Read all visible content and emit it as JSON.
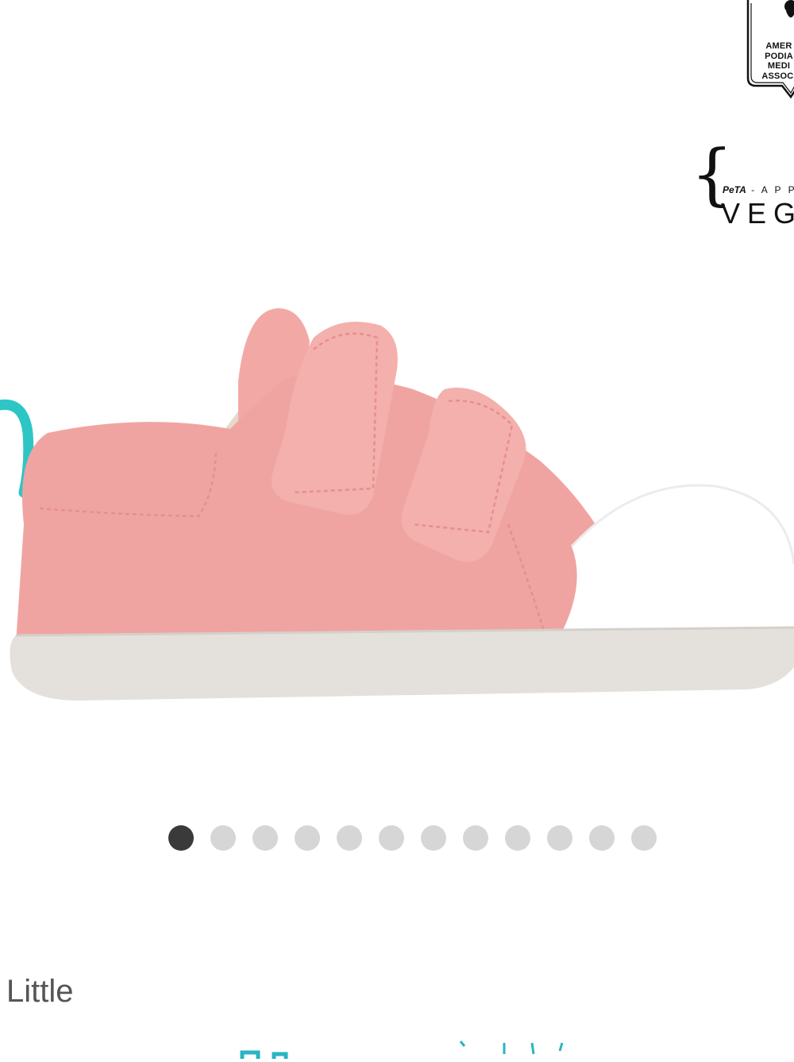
{
  "badges": {
    "apma": {
      "lines": [
        "AMER",
        "PODIA",
        "MEDI",
        "ASSOCI"
      ]
    },
    "peta": {
      "logo": "PeTA",
      "top_suffix": "- A P P R",
      "main": "VEG"
    }
  },
  "product": {
    "image_icon": "pink-velcro-sneaker-image",
    "colors": {
      "upper": "#f0a4a2",
      "toe_cap": "#ffffff",
      "sole": "#e4e1dc",
      "heel_tab": "#2ec5c5"
    }
  },
  "carousel": {
    "total": 12,
    "active_index": 0,
    "active_color": "#3a3a3a",
    "inactive_color": "#d6d6d6"
  },
  "section": {
    "category_label": "Little"
  },
  "colors": {
    "accent_teal": "#2ab5c0"
  }
}
